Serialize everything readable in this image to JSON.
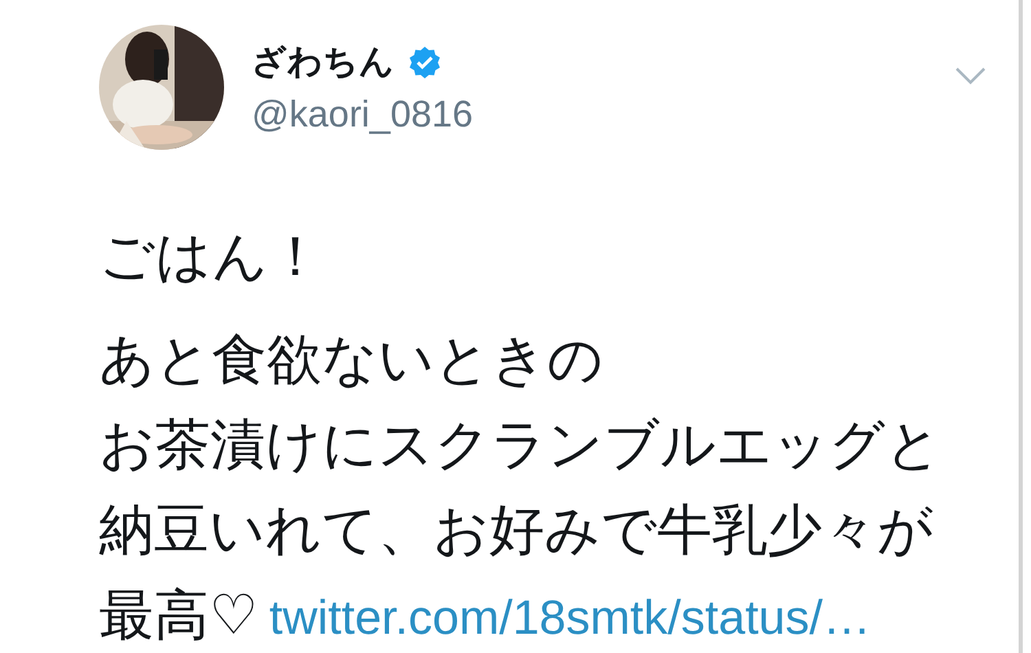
{
  "author": {
    "name": "ざわちん",
    "verified": true,
    "handle": "@kaori_0816"
  },
  "paragraphs": [
    {
      "lines": [
        "ごはん！"
      ]
    },
    {
      "lines": [
        "あと食欲ないときの",
        "お茶漬けにスクランブルエッグと",
        "納豆いれて、お好みで牛乳少々が",
        "最高♡"
      ],
      "link": "twitter.com/18smtk/status/…"
    }
  ]
}
